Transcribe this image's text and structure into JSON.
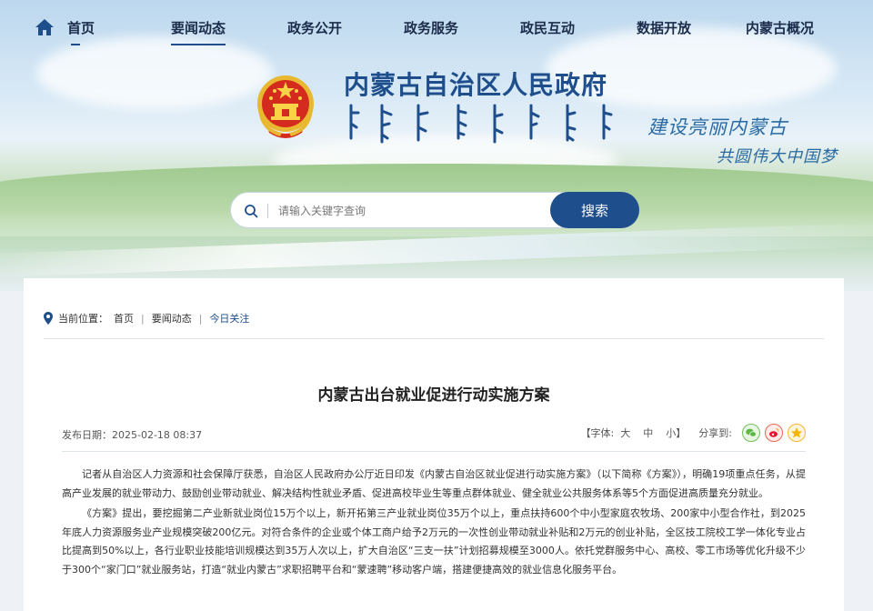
{
  "nav": {
    "items": [
      {
        "label": "首页"
      },
      {
        "label": "要闻动态"
      },
      {
        "label": "政务公开"
      },
      {
        "label": "政务服务"
      },
      {
        "label": "政民互动"
      },
      {
        "label": "数据开放"
      },
      {
        "label": "内蒙古概况"
      }
    ],
    "active_index": 1
  },
  "header": {
    "title": "内蒙古自治区人民政府",
    "slogan_line1": "建设亮丽内蒙古",
    "slogan_line2": "共圆伟大中国梦"
  },
  "search": {
    "placeholder": "请输入关键字查询",
    "button_label": "搜索"
  },
  "breadcrumb": {
    "label": "当前位置：",
    "items": [
      "首页",
      "要闻动态",
      "今日关注"
    ]
  },
  "article": {
    "title": "内蒙古出台就业促进行动实施方案",
    "date_label": "发布日期：",
    "date": "2025-02-18 08:37",
    "font_label": "【字体:",
    "font_large": "大",
    "font_medium": "中",
    "font_small": "小】",
    "share_label": "分享到:",
    "paragraphs": [
      "记者从自治区人力资源和社会保障厅获悉，自治区人民政府办公厅近日印发《内蒙古自治区就业促进行动实施方案》（以下简称《方案》），明确19项重点任务，从提高产业发展的就业带动力、鼓励创业带动就业、解决结构性就业矛盾、促进高校毕业生等重点群体就业、健全就业公共服务体系等5个方面促进高质量充分就业。",
      "《方案》提出，要挖掘第二产业新就业岗位15万个以上，新开拓第三产业就业岗位35万个以上，重点扶持600个中小型家庭农牧场、200家中小型合作社，到2025年底人力资源服务业产业规模突破200亿元。对符合条件的企业或个体工商户给予2万元的一次性创业带动就业补贴和2万元的创业补贴，全区技工院校工学一体化专业占比提高到50%以上，各行业职业技能培训规模达到35万人次以上，扩大自治区“三支一扶”计划招募规模至3000人。依托党群服务中心、高校、零工市场等优化升级不少于300个“家门口”就业服务站，打造“就业内蒙古”求职招聘平台和“蒙速聘”移动客户端，搭建便捷高效的就业信息化服务平台。"
    ]
  },
  "colors": {
    "brand": "#1e4f8c",
    "nav_text": "#1a2c4a"
  }
}
